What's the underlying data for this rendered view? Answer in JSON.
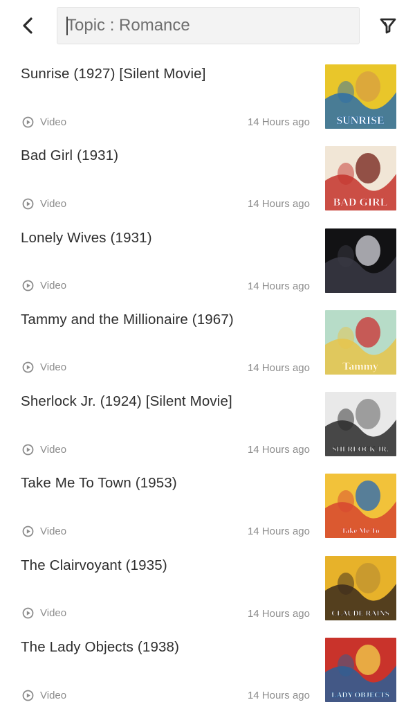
{
  "header": {
    "search_value": "Topic : Romance",
    "back_icon": "chevron-left-icon",
    "filter_icon": "filter-icon"
  },
  "items": [
    {
      "title": "Sunrise (1927) [Silent Movie]",
      "type": "Video",
      "time": "14 Hours ago",
      "poster_text": "SUNRISE",
      "colors": [
        "#e9c62a",
        "#2d6ea8",
        "#d8a040"
      ]
    },
    {
      "title": "Bad Girl (1931)",
      "type": "Video",
      "time": "14 Hours ago",
      "poster_text": "BAD GIRL",
      "colors": [
        "#f1e6d6",
        "#c4322b",
        "#7a2a22"
      ]
    },
    {
      "title": "Lonely Wives (1931)",
      "type": "Video",
      "time": "14 Hours ago",
      "poster_text": "",
      "colors": [
        "#121214",
        "#3a3a44",
        "#c9c9cf"
      ]
    },
    {
      "title": "Tammy and the Millionaire (1967)",
      "type": "Video",
      "time": "14 Hours ago",
      "poster_text": "Tammy",
      "colors": [
        "#b7dcc8",
        "#e8c44a",
        "#c93a3a"
      ]
    },
    {
      "title": "Sherlock Jr. (1924) [Silent Movie]",
      "type": "Video",
      "time": "14 Hours ago",
      "poster_text": "SHERLOCK JR.",
      "colors": [
        "#e9e9e9",
        "#2a2a2a",
        "#8a8a8a"
      ]
    },
    {
      "title": "Take Me To Town (1953)",
      "type": "Video",
      "time": "14 Hours ago",
      "poster_text": "Take Me To",
      "colors": [
        "#f2c23a",
        "#d7462f",
        "#2f6db0"
      ]
    },
    {
      "title": "The Clairvoyant (1935)",
      "type": "Video",
      "time": "14 Hours ago",
      "poster_text": "CLAUDE RAINS",
      "colors": [
        "#e7b22a",
        "#3a2a1c",
        "#c2932f"
      ]
    },
    {
      "title": "The Lady Objects (1938)",
      "type": "Video",
      "time": "14 Hours ago",
      "poster_text": "LADY OBJECTS",
      "colors": [
        "#c9332b",
        "#2b5f96",
        "#f0c84a"
      ]
    }
  ]
}
